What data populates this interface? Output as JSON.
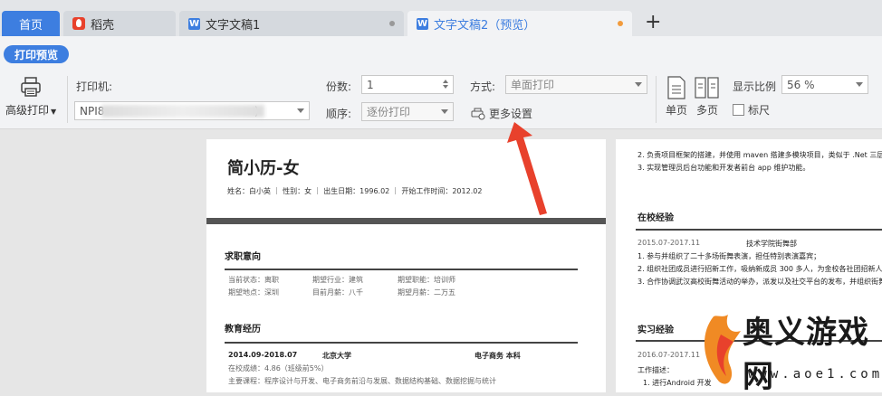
{
  "tabs": [
    {
      "label": "首页"
    },
    {
      "label": "稻壳"
    },
    {
      "label": "文字文稿1"
    },
    {
      "label": "文字文稿2（预览）"
    }
  ],
  "add_tab": "+",
  "toolbar": {
    "print_preview": "打印预览",
    "advanced_print": "高级打印",
    "printer_label": "打印机:",
    "printer_value_left": "NPI8",
    "printer_value_right": ")",
    "copies_label": "份数:",
    "copies_value": "1",
    "order_label": "顺序:",
    "order_value": "逐份打印",
    "mode_label": "方式:",
    "mode_value": "单面打印",
    "more_settings": "更多设置",
    "single_page": "单页",
    "multi_page": "多页",
    "zoom_label": "显示比例",
    "zoom_value": "56 %",
    "ruler": "标尺"
  },
  "page1": {
    "title": "简小历-女",
    "info": "姓名：白小英 ｜ 性别：女 ｜ 出生日期：1996.02 ｜ 开始工作时间：2012.02",
    "sec1": "求职意向",
    "row1": [
      "当前状态：离职",
      "期望行业：建筑",
      "期望职能：培训师"
    ],
    "row2": [
      "期望地点：深圳",
      "目前月薪：八千",
      "期望月薪：二万五"
    ],
    "sec2": "教育经历",
    "edu_date": "2014.09-2018.07",
    "edu_school": "北京大学",
    "edu_major": "电子商务 本科",
    "edu_gpa": "在校成绩：4.86（班级前5%）",
    "edu_courses": "主要课程：程序设计与开发、电子商务前沿与发展、数据结构基础、数据挖掘与统计"
  },
  "page2": {
    "line1": "2. 负责项目框架的搭建，并使用 maven 搭建多模块项目，类似于 .Net 三层架构",
    "line2": "3. 实现管理员后台功能和开发者前台 app 维护功能。",
    "sec1": "在校经验",
    "date1": "2015.07-2017.11",
    "org1": "技术学院街舞部",
    "item1": "1. 参与并组织了二十多场街舞表演，担任特别表演嘉宾；",
    "item2": "2. 组织社团成员进行招新工作，吸纳新成员 300 多人，为金校各社团招新人数",
    "item3": "3. 合作协调武汉高校街舞活动的举办，派发以及社交平台的发布，并组织街舞",
    "sec2": "实习经验",
    "date2": "2016.07-2017.11",
    "desc": "工作描述：",
    "item4": "1. 进行Android 开发"
  },
  "watermark": {
    "text": "奥义游戏网",
    "url": "www.aoe1.com"
  },
  "colors": {
    "accent": "#3d7ee0",
    "arrow": "#e8412c"
  }
}
